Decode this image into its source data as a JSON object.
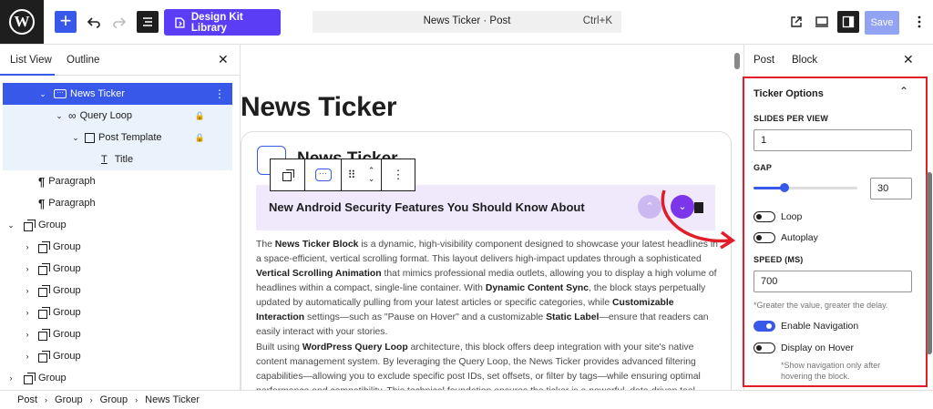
{
  "topbar": {
    "design_kit_label": "Design Kit Library",
    "command_title": "News Ticker · Post",
    "command_shortcut": "Ctrl+K",
    "save_label": "Save"
  },
  "left_panel": {
    "tabs": [
      "List View",
      "Outline"
    ],
    "tree": [
      {
        "label": "News Ticker"
      },
      {
        "label": "Query Loop"
      },
      {
        "label": "Post Template"
      },
      {
        "label": "Title"
      },
      {
        "label": "Paragraph"
      },
      {
        "label": "Paragraph"
      },
      {
        "label": "Group"
      },
      {
        "label": "Group"
      },
      {
        "label": "Group"
      },
      {
        "label": "Group"
      },
      {
        "label": "Group"
      },
      {
        "label": "Group"
      },
      {
        "label": "Group"
      },
      {
        "label": "Group"
      }
    ]
  },
  "canvas": {
    "page_title": "News Ticker",
    "block_title": "News Ticker",
    "ticker_headline": "New Android Security Features You Should Know About",
    "paragraph1": [
      {
        "t": "The "
      },
      {
        "b": "News Ticker Block"
      },
      {
        "t": " is a dynamic, high-visibility component designed to showcase your latest headlines in a space-efficient, vertical scrolling format. This layout delivers high-impact updates through a sophisticated "
      },
      {
        "b": "Vertical Scrolling Animation"
      },
      {
        "t": " that mimics professional media outlets, allowing you to display a high volume of headlines within a compact, single-line container. With "
      },
      {
        "b": "Dynamic Content Sync"
      },
      {
        "t": ", the block stays perpetually updated by automatically pulling from your latest articles or specific categories, while "
      },
      {
        "b": "Customizable Interaction"
      },
      {
        "t": " settings—such as \"Pause on Hover\" and a customizable "
      },
      {
        "b": "Static Label"
      },
      {
        "t": "—ensure that readers can easily interact with your stories."
      }
    ],
    "paragraph2": [
      {
        "t": "Built using "
      },
      {
        "b": "WordPress Query Loop"
      },
      {
        "t": " architecture, this block offers deep integration with your site's native content management system. By leveraging the Query Loop, the News Ticker provides advanced filtering capabilities—allowing you to exclude specific post IDs, set offsets, or filter by tags—while ensuring optimal performance and compatibility. This technical foundation ensures the ticker is a powerful, data-driven tool"
      }
    ]
  },
  "right_panel": {
    "tabs": [
      "Post",
      "Block"
    ],
    "section_title": "Ticker Options",
    "slides_label": "SLIDES PER VIEW",
    "slides_value": "1",
    "gap_label": "GAP",
    "gap_value": "30",
    "gap_fraction": 0.3,
    "loop_label": "Loop",
    "loop_on": false,
    "autoplay_label": "Autoplay",
    "autoplay_on": false,
    "speed_label": "SPEED (MS)",
    "speed_value": "700",
    "speed_help": "*Greater the value, greater the delay.",
    "enable_nav_label": "Enable Navigation",
    "enable_nav_on": true,
    "display_hover_label": "Display on Hover",
    "display_hover_on": false,
    "hover_help": "*Show navigation only after hovering the block.",
    "highlight_color": "#e11d2a"
  },
  "breadcrumb": [
    "Post",
    "Group",
    "Group",
    "News Ticker"
  ],
  "colors": {
    "accent": "#3858e9",
    "design_kit": "#5b3df5",
    "ticker_bg": "#efe9fb",
    "nav_active": "#7a36e8"
  }
}
